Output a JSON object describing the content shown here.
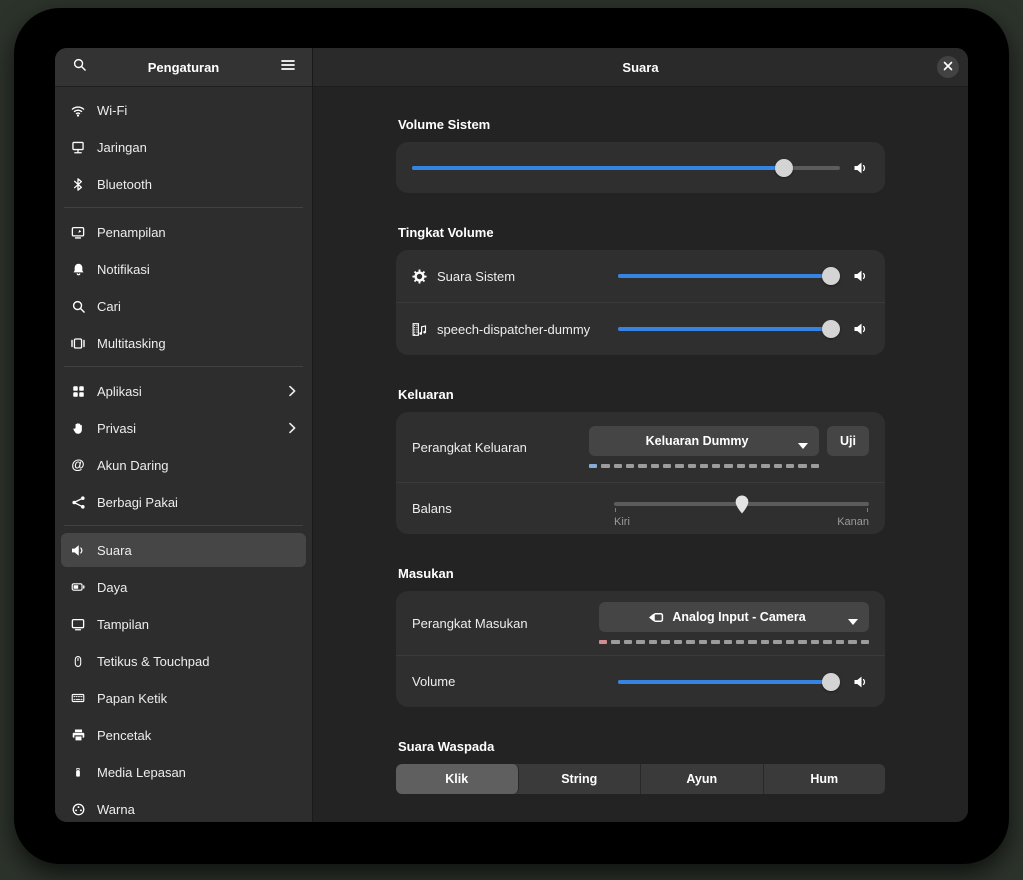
{
  "window": {
    "sidebar_title": "Pengaturan",
    "content_title": "Suara"
  },
  "sidebar": {
    "items": [
      {
        "label": "Wi-Fi",
        "icon": "wifi"
      },
      {
        "label": "Jaringan",
        "icon": "network"
      },
      {
        "label": "Bluetooth",
        "icon": "bluetooth",
        "divider_after": true
      },
      {
        "label": "Penampilan",
        "icon": "appearance"
      },
      {
        "label": "Notifikasi",
        "icon": "bell"
      },
      {
        "label": "Cari",
        "icon": "search"
      },
      {
        "label": "Multitasking",
        "icon": "multitasking",
        "divider_after": true
      },
      {
        "label": "Aplikasi",
        "icon": "apps",
        "chevron": true
      },
      {
        "label": "Privasi",
        "icon": "hand",
        "chevron": true
      },
      {
        "label": "Akun Daring",
        "icon": "at"
      },
      {
        "label": "Berbagi Pakai",
        "icon": "share",
        "divider_after": true
      },
      {
        "label": "Suara",
        "icon": "speaker",
        "selected": true
      },
      {
        "label": "Daya",
        "icon": "battery"
      },
      {
        "label": "Tampilan",
        "icon": "display"
      },
      {
        "label": "Tetikus & Touchpad",
        "icon": "mouse"
      },
      {
        "label": "Papan Ketik",
        "icon": "keyboard"
      },
      {
        "label": "Pencetak",
        "icon": "printer"
      },
      {
        "label": "Media Lepasan",
        "icon": "usb"
      },
      {
        "label": "Warna",
        "icon": "color"
      }
    ]
  },
  "sections": {
    "system_volume": {
      "heading": "Volume Sistem",
      "slider": {
        "value": 87
      }
    },
    "volume_levels": {
      "heading": "Tingkat Volume",
      "rows": [
        {
          "label": "Suara Sistem",
          "icon": "gear",
          "value": 96
        },
        {
          "label": "speech-dispatcher-dummy",
          "icon": "multimedia",
          "value": 96
        }
      ]
    },
    "output": {
      "heading": "Keluaran",
      "device_label": "Perangkat Keluaran",
      "device_value": "Keluaran Dummy",
      "test_label": "Uji",
      "meter": {
        "segments": 19,
        "first_color": "#85aed6"
      },
      "balance": {
        "label": "Balans",
        "value": 50,
        "left_label": "Kiri",
        "right_label": "Kanan"
      }
    },
    "input": {
      "heading": "Masukan",
      "device_label": "Perangkat Masukan",
      "device_value": "Analog Input - Camera",
      "meter": {
        "segments": 22,
        "first_color": "#d38d92"
      },
      "volume": {
        "label": "Volume",
        "value": 96
      }
    },
    "alert": {
      "heading": "Suara Waspada",
      "options": [
        "Klik",
        "String",
        "Ayun",
        "Hum"
      ],
      "selected_index": 0
    }
  },
  "colors": {
    "accent": "#3584e4",
    "meter_inactive": "#9c9c9c"
  }
}
